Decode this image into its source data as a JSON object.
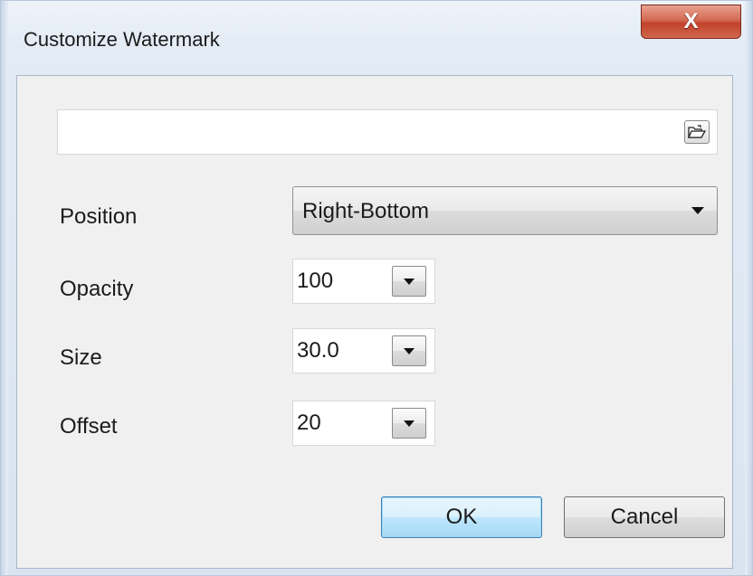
{
  "window": {
    "title": "Customize Watermark",
    "close_label": "X"
  },
  "watermark_file": {
    "value": "",
    "browse_icon": "folder-open-icon"
  },
  "position": {
    "label": "Position",
    "selected": "Right-Bottom"
  },
  "opacity": {
    "label": "Opacity",
    "value": "100"
  },
  "size": {
    "label": "Size",
    "value": "30.0"
  },
  "offset": {
    "label": "Offset",
    "value": "20"
  },
  "buttons": {
    "ok": "OK",
    "cancel": "Cancel"
  },
  "colors": {
    "close_button": "#c2412a",
    "default_button_border": "#3c7fb1",
    "dialog_background": "#f0f0f0"
  }
}
